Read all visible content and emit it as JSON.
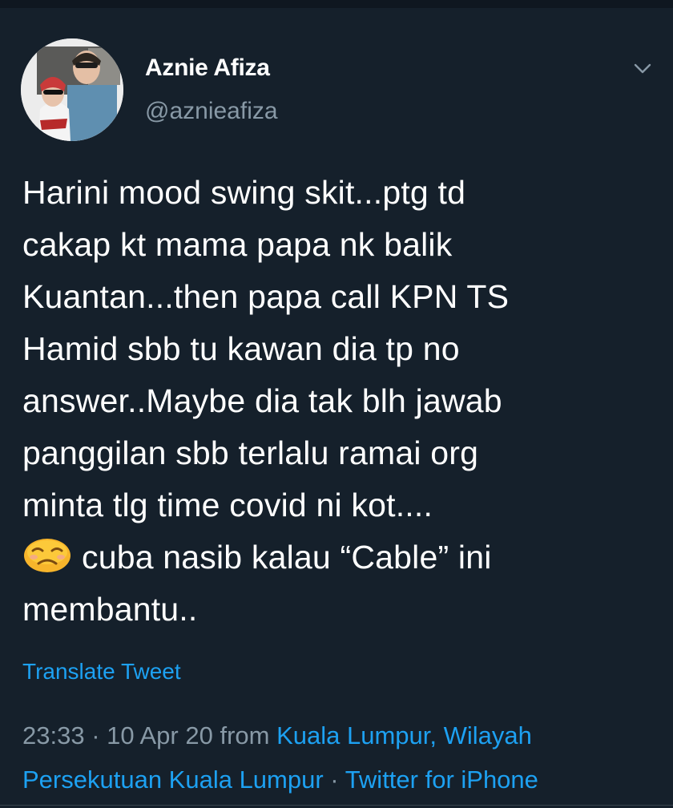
{
  "author": {
    "display_name": "Aznie Afiza",
    "handle": "@aznieafiza"
  },
  "tweet": {
    "lines": [
      "Harini mood swing skit...ptg td",
      "cakap kt mama papa nk balik",
      "Kuantan...then papa call KPN TS",
      "Hamid sbb tu kawan dia tp no",
      "answer..Maybe dia tak blh jawab",
      "panggilan sbb terlalu ramai org",
      "minta tlg time covid ni kot....",
      "cuba nasib kalau “Cable” ini",
      "membantu.."
    ],
    "emoji": "crying-face-emoji"
  },
  "translate_label": "Translate Tweet",
  "meta": {
    "time_date": "23:33 · 10 Apr 20 from ",
    "location_part1": "Kuala Lumpur, Wilayah",
    "location_part2": "Persekutuan Kuala Lumpur",
    "separator": " · ",
    "source": "Twitter for iPhone"
  },
  "icons": {
    "caret": "chevron-down-icon"
  },
  "colors": {
    "background": "#15202b",
    "text": "#ffffff",
    "secondary_text": "#8899a6",
    "link": "#1da1f2"
  }
}
